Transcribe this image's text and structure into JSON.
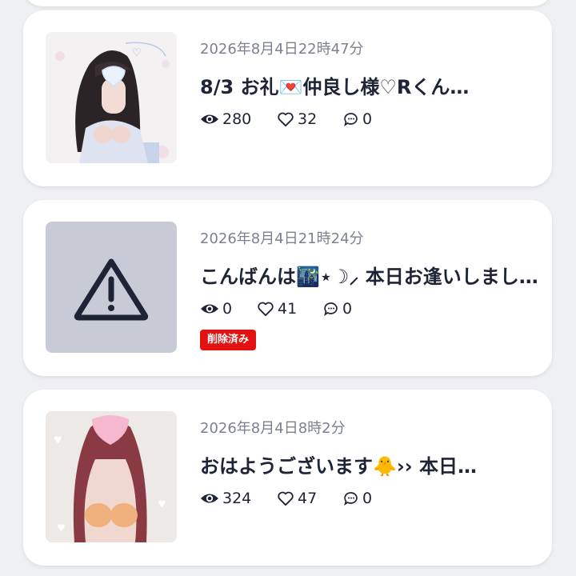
{
  "posts": [
    {
      "date": "2026年8月4日22時47分",
      "title": "8/3 お礼💌仲良し様♡Rくん…",
      "views": "280",
      "likes": "32",
      "comments": "0",
      "thumbnail": "photo",
      "deleted": false
    },
    {
      "date": "2026年8月4日21時24分",
      "title": "こんばんは🌃⋆☽⸝ 本日お逢いしまし…",
      "views": "0",
      "likes": "41",
      "comments": "0",
      "thumbnail": "warning-icon",
      "deleted": true,
      "badge": "削除済み"
    },
    {
      "date": "2026年8月4日8時2分",
      "title": "おはようございます🐥›› 本日…",
      "views": "324",
      "likes": "47",
      "comments": "0",
      "thumbnail": "photo",
      "deleted": false
    }
  ],
  "colors": {
    "background": "#eef0f3",
    "card": "#ffffff",
    "text": "#1e2436",
    "date": "#7d8090",
    "badge": "#e31212",
    "placeholder": "#c8cbd6"
  }
}
